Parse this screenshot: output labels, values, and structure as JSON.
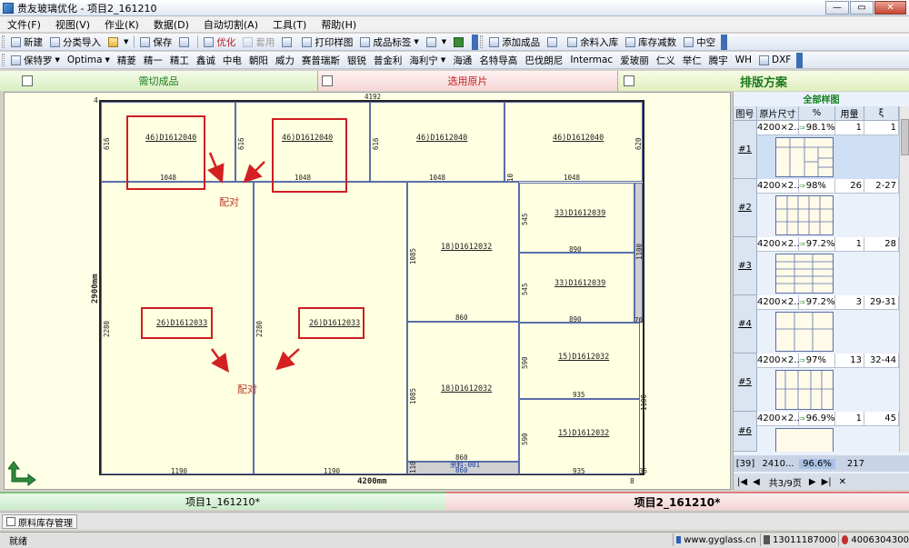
{
  "window": {
    "title": "贵友玻璃优化 - 项目2_161210",
    "min_label": "—",
    "max_label": "▭",
    "close_label": "✕"
  },
  "menu": [
    "文件(F)",
    "视图(V)",
    "作业(K)",
    "数据(D)",
    "自动切割(A)",
    "工具(T)",
    "帮助(H)"
  ],
  "toolbar1": {
    "new": "新建",
    "classify_import": "分类导入",
    "save": "保存",
    "optimize": "优化",
    "cover": "套用",
    "print_sample": "打印样图",
    "product_label": "成品标签",
    "add_product": "添加成品",
    "remnant_in": "余料入库",
    "stock_reduce": "库存减数",
    "hollow": "中空"
  },
  "toolbar2": [
    "保特罗",
    "Optima",
    "精菱",
    "精一",
    "精工",
    "鑫诚",
    "中电",
    "朝阳",
    "威力",
    "赛普瑞斯",
    "银锐",
    "普金利",
    "海利宁",
    "海通",
    "名特导高",
    "巴伐朗尼",
    "Intermac",
    "爱玻丽",
    "仁义",
    "举仁",
    "腾宇",
    "WH",
    "DXF"
  ],
  "tabs": {
    "cut_products": "需切成品",
    "select_sheet": "选用原片",
    "layout_plan": "排版方案"
  },
  "layout": {
    "sheet_width_label": "4200mm",
    "sheet_height_label": "2900mm",
    "top_dim": "4192",
    "corner_tl": "4",
    "corner_br": "8",
    "pair_label": "配对",
    "pieces": [
      {
        "label": "46)D1612040",
        "w": "1048",
        "h": "616"
      },
      {
        "label": "46)D1612040",
        "w": "1048",
        "h": "616"
      },
      {
        "label": "46)D1612040",
        "w": "1048",
        "h": "616"
      },
      {
        "label": "46)D1612040",
        "w": "1048",
        "h": "620"
      },
      {
        "label": "26)D1612033",
        "w": "1190",
        "h": "2280"
      },
      {
        "label": "26)D1612033",
        "w": "1190",
        "h": "2280"
      },
      {
        "label": "18)D1612032",
        "w": "860",
        "h": "1085"
      },
      {
        "label": "18)D1612032",
        "w": "860",
        "h": "1085"
      },
      {
        "label": "33)D1612039",
        "w": "890",
        "h": "545"
      },
      {
        "label": "33)D1612039",
        "w": "890",
        "h": "545"
      },
      {
        "label": "15)D1612032",
        "w": "935",
        "h": "590"
      },
      {
        "label": "15)D1612032",
        "w": "935",
        "h": "590"
      }
    ],
    "remnant_label": "余料-001",
    "remnant_w": "860",
    "remnant_h": "110",
    "edge_10": "10",
    "edge_70": "70",
    "edge_1100_a": "1100",
    "edge_1100_b": "1100",
    "edge_35": "35"
  },
  "right_panel": {
    "title": "全部样图",
    "headers": [
      "图号",
      "原片尺寸",
      "%",
      "用量",
      "ξ"
    ],
    "rows": [
      {
        "num": "#1",
        "size": "4200×2...",
        "pct": "98.1%",
        "qty": "1",
        "xi": "1"
      },
      {
        "num": "#2",
        "size": "4200×2...",
        "pct": "98%",
        "qty": "26",
        "xi": "2-27"
      },
      {
        "num": "#3",
        "size": "4200×2...",
        "pct": "97.2%",
        "qty": "1",
        "xi": "28"
      },
      {
        "num": "#4",
        "size": "4200×2...",
        "pct": "97.2%",
        "qty": "3",
        "xi": "29-31"
      },
      {
        "num": "#5",
        "size": "4200×2...",
        "pct": "97%",
        "qty": "13",
        "xi": "32-44"
      },
      {
        "num": "#6",
        "size": "4200×2...",
        "pct": "96.9%",
        "qty": "1",
        "xi": "45"
      }
    ],
    "footer": {
      "count": "[39]",
      "size": "2410...",
      "pct": "96.6%",
      "qty": "217"
    },
    "pager": "共3/9页"
  },
  "project_tabs": {
    "tab1": "项目1_161210*",
    "tab2": "项目2_161210*"
  },
  "stock_mgmt": "原料库存管理",
  "status": {
    "ready": "就绪",
    "website": "www.gyglass.cn",
    "phone": "13011187000",
    "hotline": "4006304300"
  }
}
